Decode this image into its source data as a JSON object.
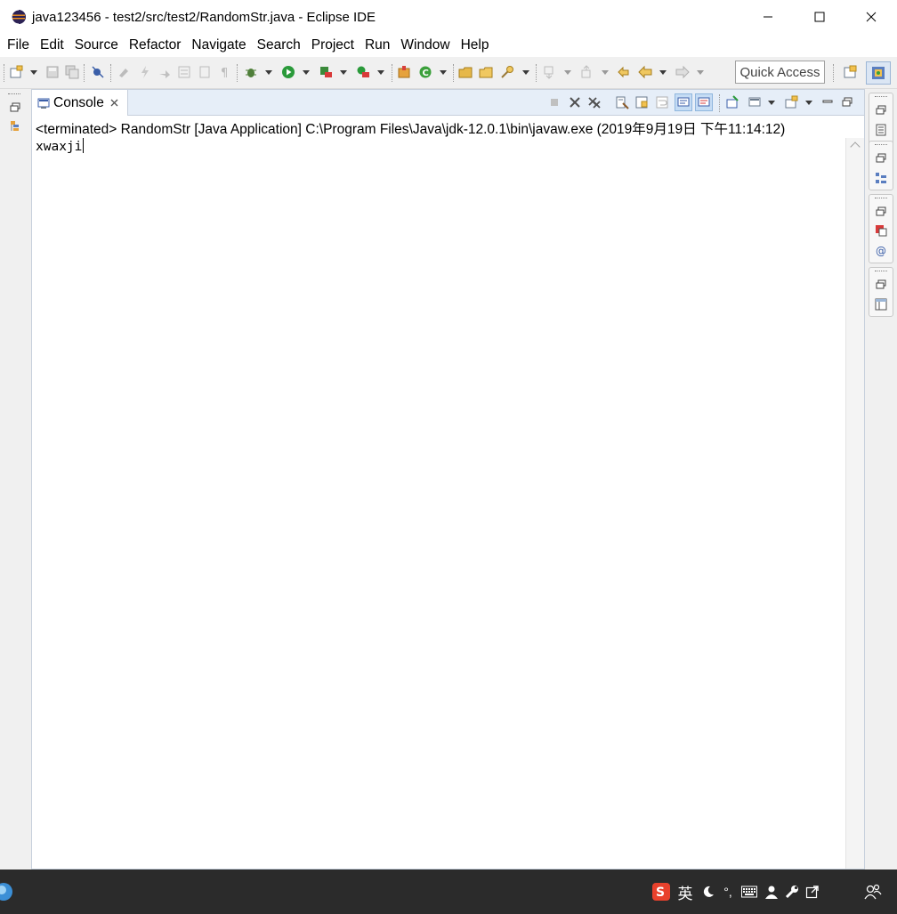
{
  "window": {
    "title": "java123456 - test2/src/test2/RandomStr.java - Eclipse IDE",
    "app_icon": "eclipse-icon",
    "controls": [
      "minimize-icon",
      "maximize-icon",
      "close-icon"
    ]
  },
  "menu": {
    "items": [
      "File",
      "Edit",
      "Source",
      "Refactor",
      "Navigate",
      "Search",
      "Project",
      "Run",
      "Window",
      "Help"
    ]
  },
  "toolbar": {
    "quick_access_placeholder": "Quick Access"
  },
  "console": {
    "tab_label": "Console",
    "header": "<terminated> RandomStr [Java Application] C:\\Program Files\\Java\\jdk-12.0.1\\bin\\javaw.exe (2019年9月19日 下午11:14:12)",
    "output": "xwaxji"
  },
  "taskbar": {
    "ime_label": "英",
    "punct_label": "°,"
  },
  "colors": {
    "view_border": "#c7d0dc",
    "tabbar_bg": "#e6eef8",
    "taskbar_bg": "#2b2b2b",
    "ime_red": "#e8412c"
  }
}
